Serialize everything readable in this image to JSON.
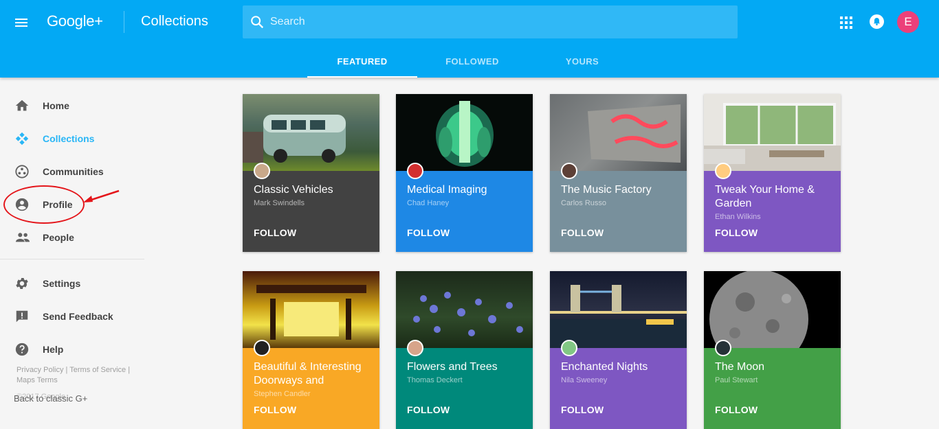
{
  "header": {
    "logo": "Google+",
    "section_title": "Collections",
    "search_placeholder": "Search",
    "avatar_letter": "E",
    "menu_icon": "hamburger-icon",
    "apps_icon": "apps-grid-icon",
    "notifications_icon": "bell-icon",
    "color": "#03a9f4"
  },
  "tabs": [
    {
      "label": "FEATURED",
      "active": true
    },
    {
      "label": "FOLLOWED",
      "active": false
    },
    {
      "label": "YOURS",
      "active": false
    }
  ],
  "sidebar": {
    "items": [
      {
        "label": "Home",
        "icon": "home-icon",
        "active": false
      },
      {
        "label": "Collections",
        "icon": "collections-icon",
        "active": true
      },
      {
        "label": "Communities",
        "icon": "communities-icon",
        "active": false
      },
      {
        "label": "Profile",
        "icon": "profile-icon",
        "active": false
      },
      {
        "label": "People",
        "icon": "people-icon",
        "active": false
      },
      {
        "label": "Settings",
        "icon": "gear-icon",
        "active": false
      },
      {
        "label": "Send Feedback",
        "icon": "feedback-icon",
        "active": false
      },
      {
        "label": "Help",
        "icon": "help-icon",
        "active": false
      }
    ],
    "footer_links": [
      "Privacy Policy",
      "Terms of Service",
      "Maps Terms"
    ],
    "copyright": "©2017 Google",
    "back_link": "Back to classic G+"
  },
  "annotation": {
    "highlight_color": "#e4161b"
  },
  "collections": [
    {
      "title": "Classic Vehicles",
      "owner": "Mark Swindells",
      "action": "FOLLOW",
      "color": "#424242"
    },
    {
      "title": "Medical Imaging",
      "owner": "Chad Haney",
      "action": "FOLLOW",
      "color": "#1e88e5"
    },
    {
      "title": "The Music Factory",
      "owner": "Carlos Russo",
      "action": "FOLLOW",
      "color": "#78909c"
    },
    {
      "title": "Tweak Your Home & Garden",
      "owner": "Ethan Wilkins",
      "action": "FOLLOW",
      "color": "#7e57c2"
    },
    {
      "title": "Beautiful & Interesting Doorways and",
      "owner": "Stephen Candler",
      "action": "FOLLOW",
      "color": "#f9a825"
    },
    {
      "title": "Flowers and Trees",
      "owner": "Thomas Deckert",
      "action": "FOLLOW",
      "color": "#00897b"
    },
    {
      "title": "Enchanted Nights",
      "owner": "Nila Sweeney",
      "action": "FOLLOW",
      "color": "#7e57c2"
    },
    {
      "title": "The Moon",
      "owner": "Paul Stewart",
      "action": "FOLLOW",
      "color": "#43a047"
    }
  ]
}
